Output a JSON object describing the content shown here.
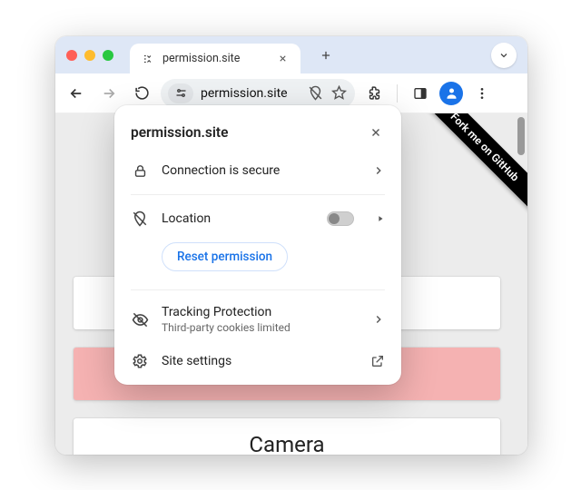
{
  "tab": {
    "title": "permission.site"
  },
  "omnibox": {
    "url": "permission.site"
  },
  "ribbon": {
    "text": "Fork me on GitHub"
  },
  "page": {
    "buttons": [
      {
        "label": ""
      },
      {
        "label": ""
      },
      {
        "label": "Camera"
      }
    ]
  },
  "popover": {
    "title": "permission.site",
    "secure_label": "Connection is secure",
    "location_label": "Location",
    "reset_label": "Reset permission",
    "tracking_label": "Tracking Protection",
    "tracking_sub": "Third-party cookies limited",
    "settings_label": "Site settings"
  }
}
